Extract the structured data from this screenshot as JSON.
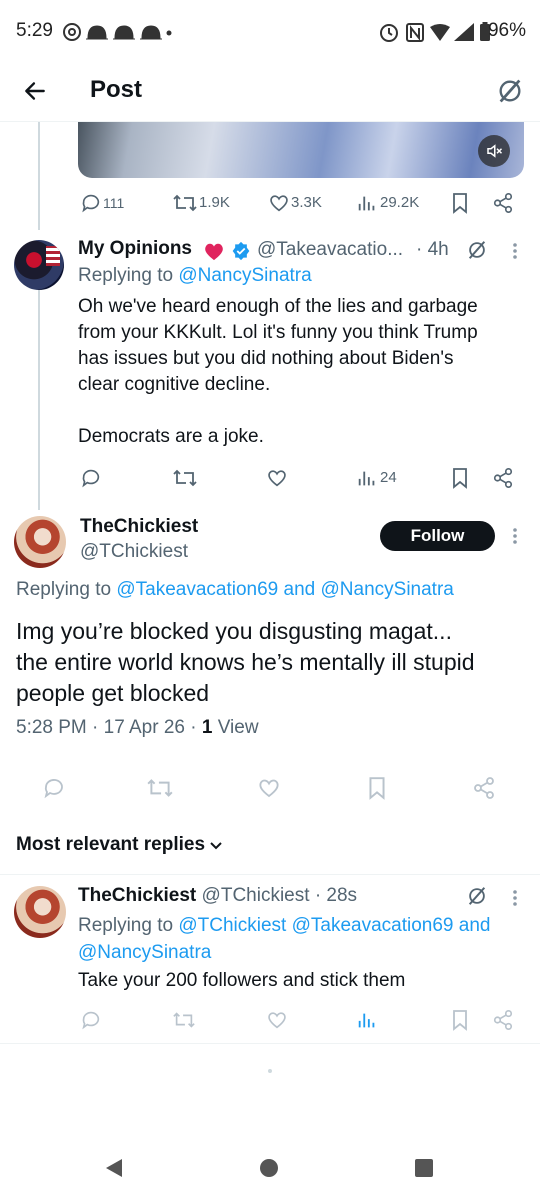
{
  "status_bar": {
    "time": "5:29",
    "battery": "96%"
  },
  "header": {
    "title": "Post"
  },
  "parent_actions": {
    "replies": "111",
    "reposts": "1.9K",
    "likes": "3.3K",
    "views": "29.2K"
  },
  "reply1": {
    "name": "My Opinions",
    "handle": "@Takeavacatio...",
    "time": "· 4h",
    "replying_prefix": "Replying to ",
    "replying_to": "@NancySinatra",
    "text_lines": [
      "Oh we've heard enough of the lies and garbage",
      "from your KKKult. Lol it's funny you think Trump",
      "has issues but you did nothing about Biden's",
      "clear cognitive decline.",
      "Democrats are a joke."
    ],
    "views": "24"
  },
  "main_post": {
    "name": "TheChickiest",
    "handle": "@TChickiest",
    "follow_label": "Follow",
    "replying_prefix": "Replying to ",
    "replying_to_1": "@Takeavacation69",
    "replying_and": " and ",
    "replying_to_2": "@NancySinatra",
    "text_lines": [
      "Img  you’re blocked you disgusting magat...",
      "the entire world knows he’s mentally ill stupid",
      "people get blocked"
    ],
    "timestamp": "5:28 PM · 17 Apr 26 · ",
    "view_count": "1",
    "view_label": " View"
  },
  "sort": {
    "label": "Most relevant replies"
  },
  "reply2": {
    "name": "TheChickiest",
    "handle": "@TChickiest",
    "time": "· 28s",
    "replying_prefix": "Replying to ",
    "replying_to_1": "@TChickiest",
    "replying_to_2": "@Takeavacation69",
    "replying_and": " and",
    "replying_to_3": "@NancySinatra",
    "text": "Take your 200 followers and stick them"
  },
  "colors": {
    "accent": "#1d9bf0",
    "text": "#0f1419",
    "muted": "#536471",
    "heart": "#e0245e"
  }
}
